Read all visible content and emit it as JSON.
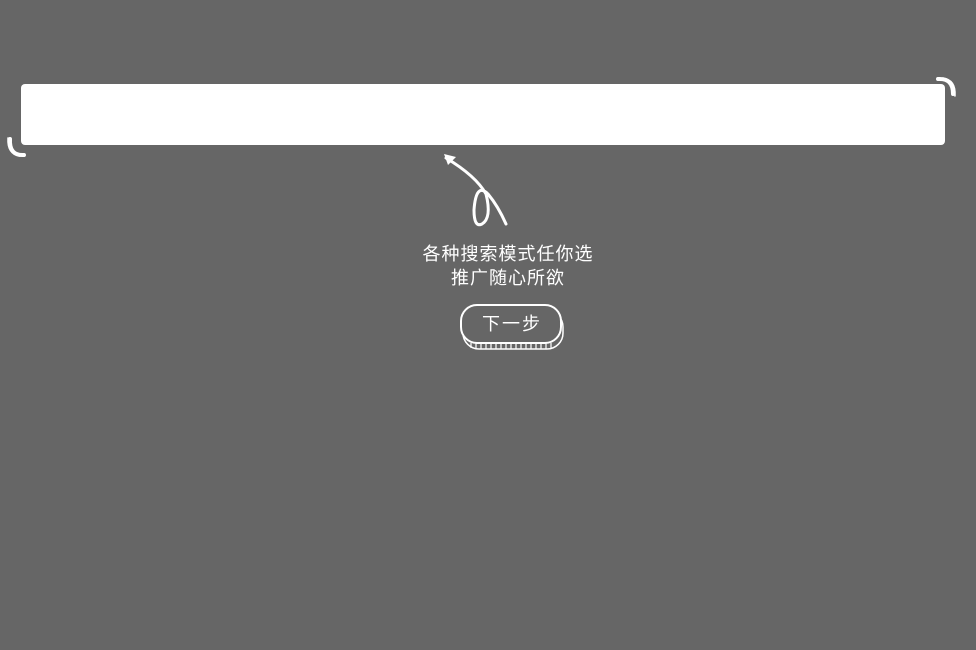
{
  "overlay": {
    "background_color": "#666666",
    "highlight_color": "#ffffff"
  },
  "guide": {
    "line1": "各种搜索模式任你选",
    "line2": "推广随心所欲",
    "next_label": "下一步"
  },
  "icons": {
    "arrow": "curly-arrow-icon",
    "corner_top_right": "corner-bracket-icon",
    "corner_bottom_left": "corner-bracket-icon"
  }
}
